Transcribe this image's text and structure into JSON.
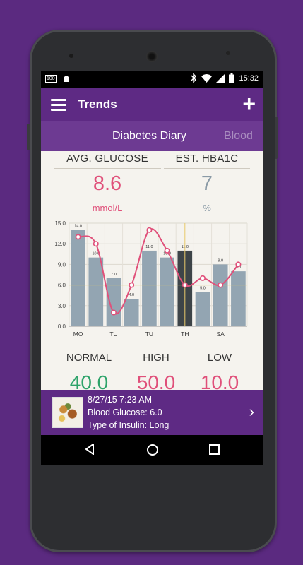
{
  "status": {
    "battery_level": "100",
    "time": "15:32"
  },
  "appbar": {
    "title": "Trends",
    "add_label": "+"
  },
  "tabs": [
    "Diabetes Diary",
    "Blood"
  ],
  "summary": {
    "avg_glucose_label": "AVG. GLUCOSE",
    "avg_glucose_value": "8.6",
    "avg_glucose_unit": "mmol/L",
    "hba1c_label": "EST. HBA1C",
    "hba1c_value": "7",
    "hba1c_unit": "%"
  },
  "colors": {
    "primary": "#5e2a84",
    "tab_bg": "#6d3a92",
    "glucose_pink": "#e0507a",
    "hba1c_gray": "#8a9aa6",
    "bar": "#93a5b2",
    "bar_selected": "#3d4448",
    "normal_green": "#2ea36a"
  },
  "chart_data": {
    "type": "bar",
    "categories": [
      "MO",
      "",
      "TU",
      "",
      "TU",
      "",
      "TH",
      "",
      "SA",
      ""
    ],
    "series": [
      {
        "values": [
          14.0,
          10.0,
          7.0,
          4.0,
          11.0,
          10.0,
          11.0,
          5.0,
          9.0,
          8.0
        ]
      },
      {
        "values": [
          13.0,
          12.0,
          2.0,
          6.0,
          14.0,
          11.0,
          6.0,
          7.0,
          6.0,
          9.0
        ]
      }
    ],
    "bar_labels": [
      "14.0",
      "10.0",
      "7.0",
      "4.0",
      "11.0",
      "10.0",
      "11.0",
      "5.0",
      "9.0",
      "8.0"
    ],
    "selected_index": 6,
    "ylim": [
      0,
      15
    ],
    "yticks": [
      "0.0",
      "3.0",
      "6.0",
      "9.0",
      "12.0",
      "15.0"
    ],
    "grid": true
  },
  "stats": {
    "normal_label": "NORMAL",
    "normal_value": "40.0",
    "high_label": "HIGH",
    "high_value": "50.0",
    "low_label": "LOW",
    "low_value": "10.0"
  },
  "entry": {
    "date": "8/27/15 7:23 AM",
    "glucose": "Blood Glucose: 6.0",
    "insulin": "Type of Insulin: Long"
  }
}
